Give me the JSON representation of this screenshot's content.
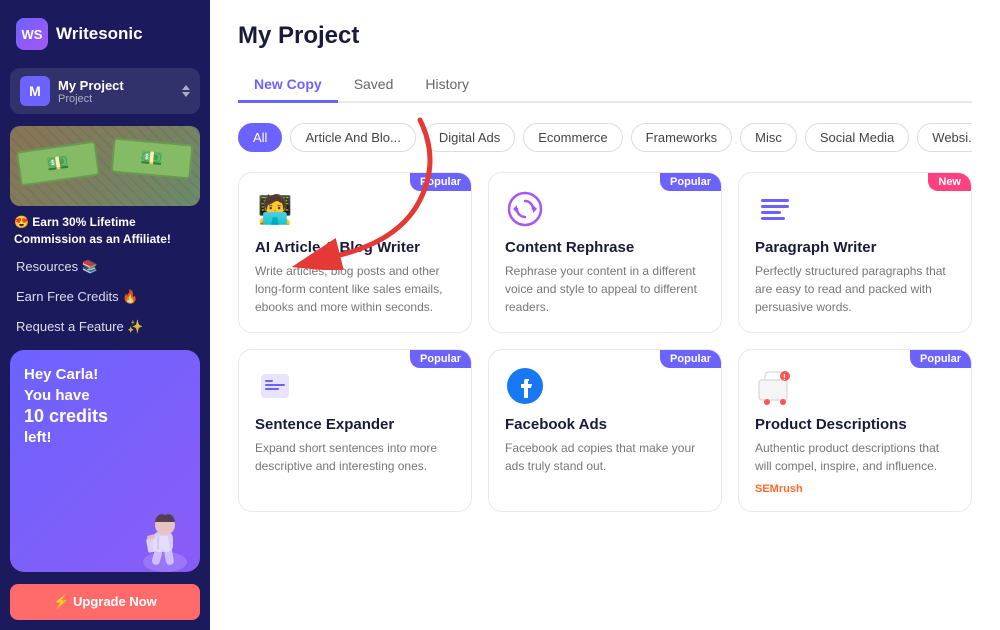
{
  "sidebar": {
    "logo_text": "Writesonic",
    "logo_abbr": "WS",
    "project": {
      "avatar_letter": "M",
      "name": "My Project",
      "type": "Project"
    },
    "affiliate_text": "😍 Earn 30% Lifetime Commission as an Affiliate!",
    "links": [
      {
        "id": "resources",
        "label": "Resources 📚"
      },
      {
        "id": "earn-credits",
        "label": "Earn Free Credits 🔥"
      },
      {
        "id": "request-feature",
        "label": "Request a Feature ✨"
      }
    ],
    "credits_card": {
      "greeting": "Hey Carla!",
      "line2": "You have",
      "credits": "10 credits",
      "line3": "left!"
    },
    "upgrade_btn": "⚡ Upgrade Now"
  },
  "header": {
    "title": "My Project"
  },
  "tabs": [
    {
      "id": "new-copy",
      "label": "New Copy",
      "active": true
    },
    {
      "id": "saved",
      "label": "Saved",
      "active": false
    },
    {
      "id": "history",
      "label": "History",
      "active": false
    }
  ],
  "filters": [
    {
      "id": "all",
      "label": "All",
      "active": true
    },
    {
      "id": "article-blog",
      "label": "Article And Blo...",
      "active": false
    },
    {
      "id": "digital-ads",
      "label": "Digital Ads",
      "active": false
    },
    {
      "id": "ecommerce",
      "label": "Ecommerce",
      "active": false
    },
    {
      "id": "frameworks",
      "label": "Frameworks",
      "active": false
    },
    {
      "id": "misc",
      "label": "Misc",
      "active": false
    },
    {
      "id": "social-media",
      "label": "Social Media",
      "active": false
    },
    {
      "id": "website",
      "label": "Websi...",
      "active": false
    }
  ],
  "cards": [
    {
      "id": "ai-article-blog",
      "icon": "🧑‍💻",
      "icon_type": "emoji",
      "title": "AI Article & Blog Writer",
      "desc": "Write articles, blog posts and other long-form content like sales emails, ebooks and more within seconds.",
      "badge": "Popular",
      "badge_type": "popular",
      "footer": ""
    },
    {
      "id": "content-rephrase",
      "icon": "↻",
      "icon_type": "symbol",
      "icon_color": "#a855f7",
      "title": "Content Rephrase",
      "desc": "Rephrase your content in a different voice and style to appeal to different readers.",
      "badge": "Popular",
      "badge_type": "popular",
      "footer": ""
    },
    {
      "id": "paragraph-writer",
      "icon": "≡",
      "icon_type": "symbol",
      "icon_color": "#6c63ff",
      "title": "Paragraph Writer",
      "desc": "Perfectly structured paragraphs that are easy to read and packed with persuasive words.",
      "badge": "New",
      "badge_type": "new",
      "footer": ""
    },
    {
      "id": "sentence-expander",
      "icon": "⬛",
      "icon_type": "custom",
      "icon_color": "#6c63ff",
      "title": "Sentence Expander",
      "desc": "Expand short sentences into more descriptive and interesting ones.",
      "badge": "Popular",
      "badge_type": "popular",
      "footer": ""
    },
    {
      "id": "facebook-ads",
      "icon": "f",
      "icon_type": "facebook",
      "icon_color": "#1877f2",
      "title": "Facebook Ads",
      "desc": "Facebook ad copies that make your ads truly stand out.",
      "badge": "Popular",
      "badge_type": "popular",
      "footer": ""
    },
    {
      "id": "product-descriptions",
      "icon": "🛒",
      "icon_type": "emoji",
      "title": "Product Descriptions",
      "desc": "Authentic product descriptions that will compel, inspire, and influence.",
      "badge": "Popular",
      "badge_type": "popular",
      "footer": "SEMrush"
    }
  ]
}
